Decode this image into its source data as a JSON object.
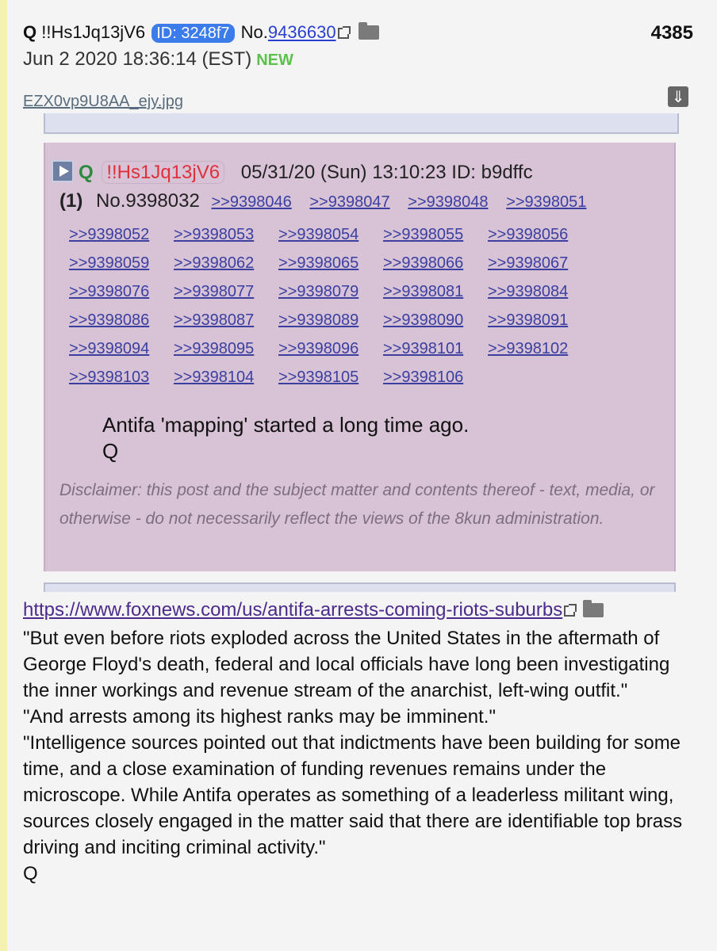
{
  "post": {
    "author": "Q",
    "tripcode": "!!Hs1Jq13jV6",
    "id_label": "ID: 3248f7",
    "no_prefix": "No.",
    "post_number": "9436630",
    "count": "4385",
    "date": "Jun 2 2020 18:36:14 (EST)",
    "new_label": "NEW",
    "filename": "EZX0vp9U8AA_ejy.jpg",
    "download_icon": "download-icon",
    "folder_icon": "folder-icon"
  },
  "embedded": {
    "author": "Q",
    "tripcode": "!!Hs1Jq13jV6",
    "datetime": "05/31/20 (Sun) 13:10:23 ID: b9dffc",
    "count": "(1)",
    "number": "No.9398032",
    "first_row_replies": [
      ">>9398046",
      ">>9398047",
      ">>9398048",
      ">>9398051"
    ],
    "replies": [
      ">>9398052",
      ">>9398053",
      ">>9398054",
      ">>9398055",
      ">>9398056",
      ">>9398059",
      ">>9398062",
      ">>9398065",
      ">>9398066",
      ">>9398067",
      ">>9398076",
      ">>9398077",
      ">>9398079",
      ">>9398081",
      ">>9398084",
      ">>9398086",
      ">>9398087",
      ">>9398089",
      ">>9398090",
      ">>9398091",
      ">>9398094",
      ">>9398095",
      ">>9398096",
      ">>9398101",
      ">>9398102",
      ">>9398103",
      ">>9398104",
      ">>9398105",
      ">>9398106"
    ],
    "message_line1": "Antifa 'mapping' started a long time ago.",
    "message_line2": "Q",
    "disclaimer": "Disclaimer: this post and the subject matter and contents thereof - text, media, or otherwise - do not necessarily reflect the views of the 8kun administration."
  },
  "link": {
    "url": "https://www.foxnews.com/us/antifa-arrests-coming-riots-suburbs"
  },
  "body": {
    "p1": "\"But even before riots exploded across the United States in the aftermath of George Floyd's death, federal and local officials have long been investigating the inner workings and revenue stream of the anarchist, left-wing outfit.\"",
    "p2": "\"And arrests among its highest ranks may be imminent.\"",
    "p3": "\"Intelligence sources pointed out that indictments have been building for some time, and a close examination of funding revenues remains under the microscope. While Antifa operates as something of a leaderless militant wing, sources closely engaged in the matter said that there are identifiable top brass driving and inciting criminal activity.\"",
    "signature": "Q"
  }
}
